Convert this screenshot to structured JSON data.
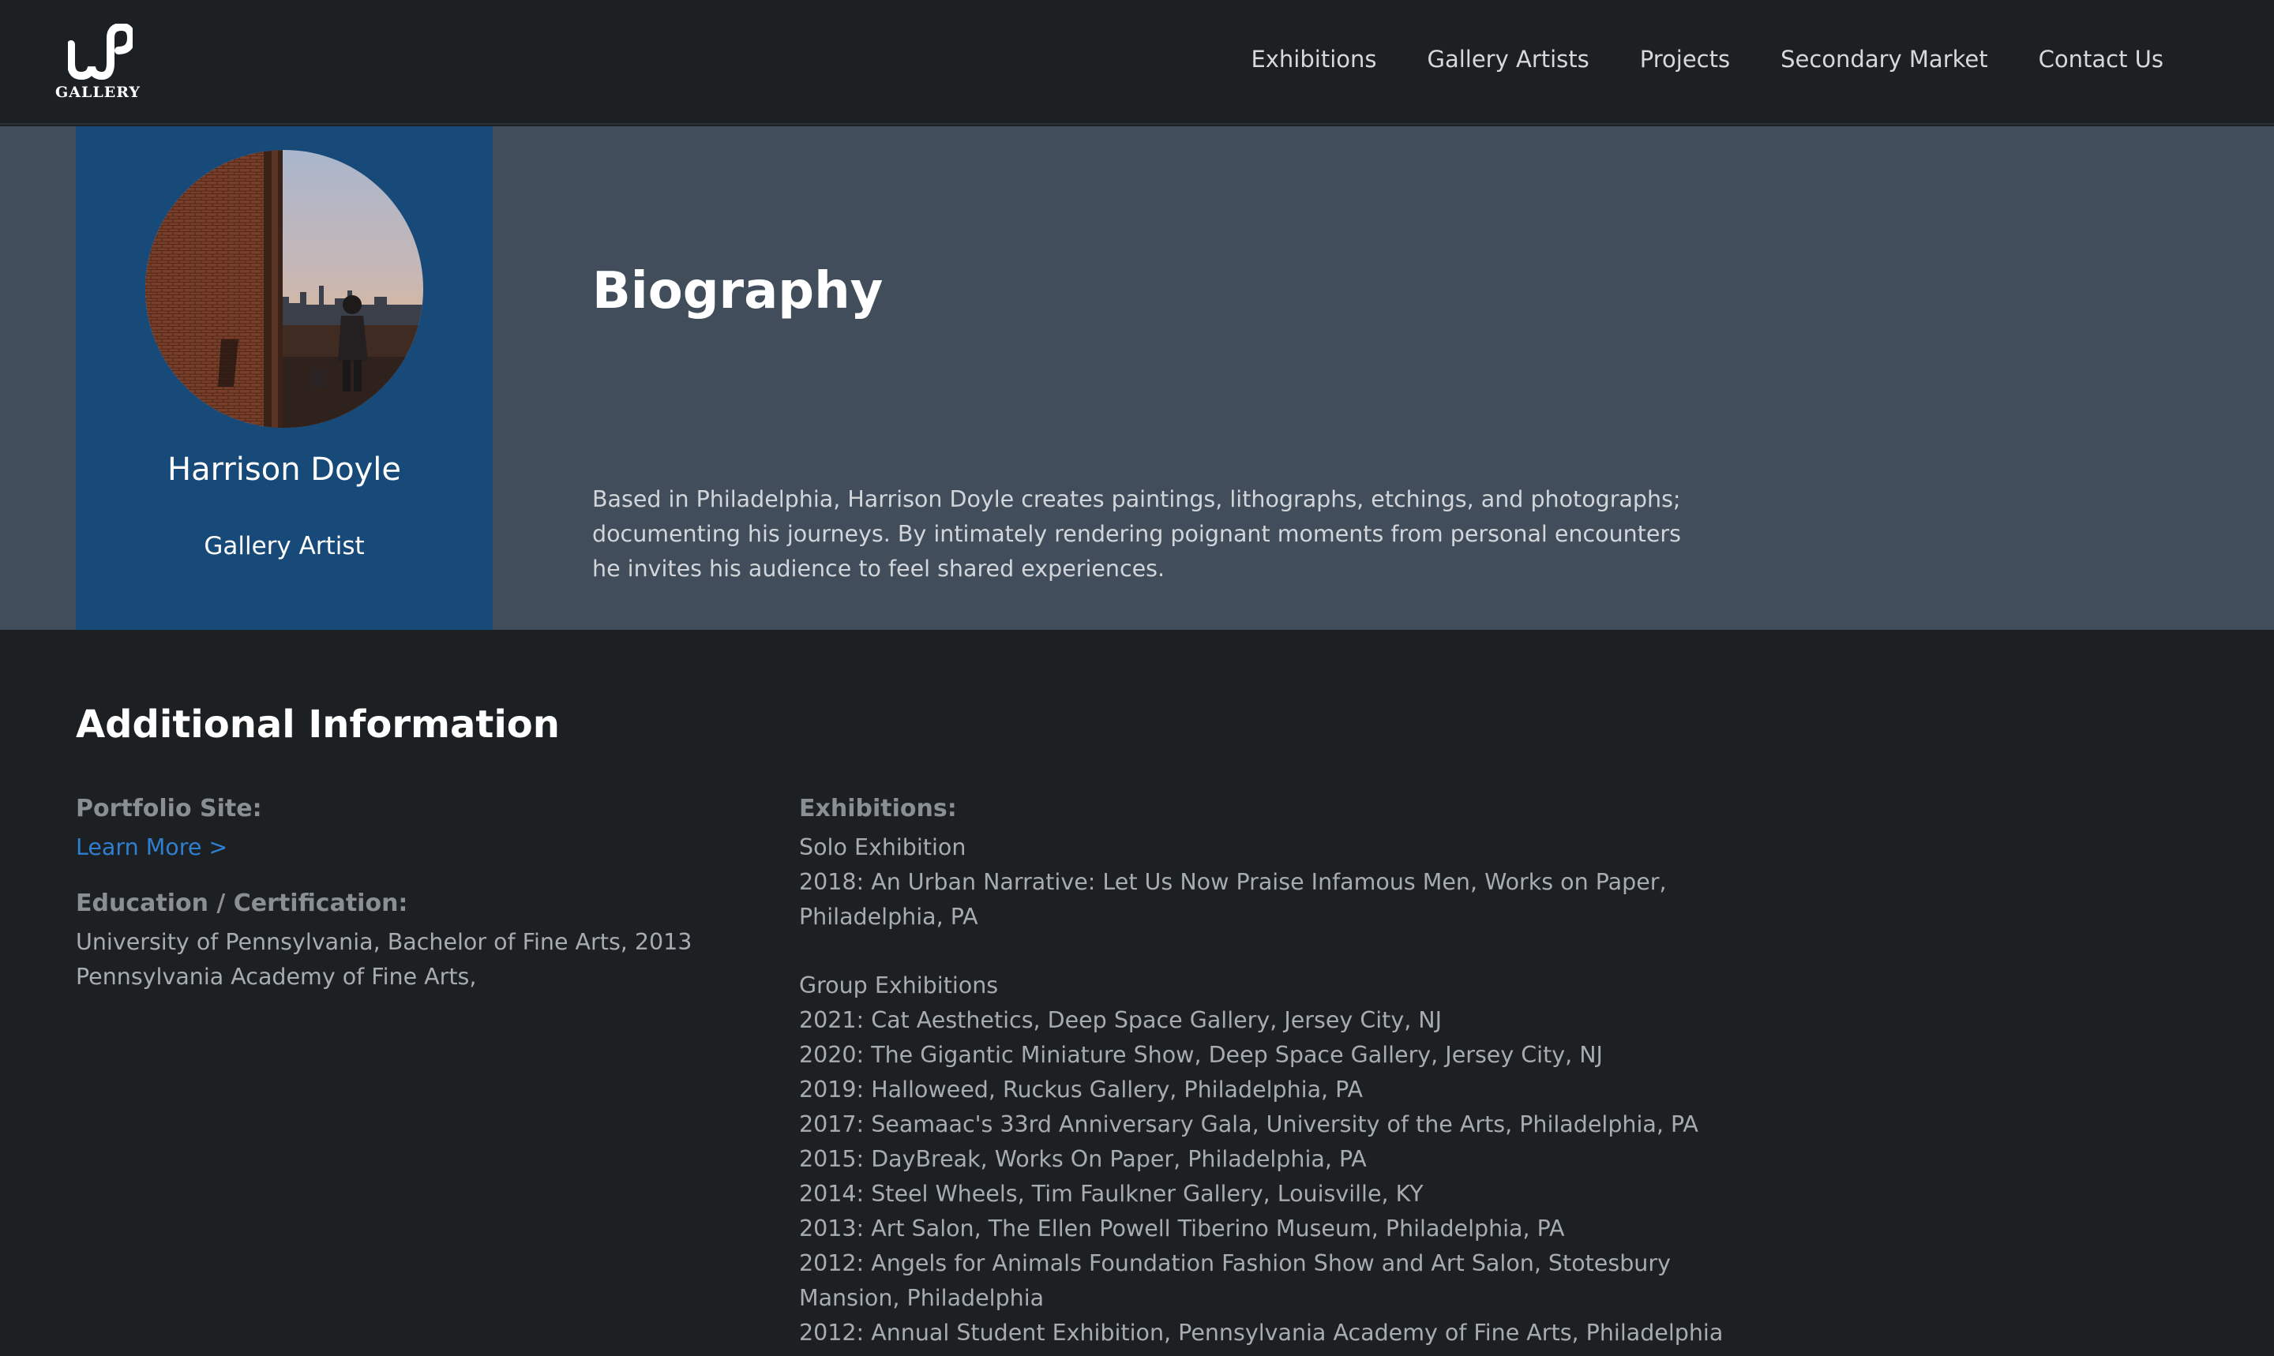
{
  "header": {
    "logo_word": "GALLERY",
    "nav": [
      "Exhibitions",
      "Gallery Artists",
      "Projects",
      "Secondary Market",
      "Contact Us"
    ]
  },
  "artist": {
    "name": "Harrison Doyle",
    "role": "Gallery Artist"
  },
  "biography": {
    "title": "Biography",
    "text": "Based in Philadelphia, Harrison Doyle creates paintings, lithographs, etchings, and photographs; documenting his journeys. By intimately rendering poignant moments from personal encounters he invites his audience to feel shared experiences."
  },
  "additional_info": {
    "title": "Additional Information",
    "portfolio_label": "Portfolio Site:",
    "portfolio_link": "Learn More >",
    "education_label": "Education / Certification:",
    "education": [
      "University of Pennsylvania, Bachelor of Fine Arts, 2013",
      "Pennsylvania Academy of Fine Arts,"
    ],
    "exhibitions_label": "Exhibitions:",
    "solo_heading": "Solo Exhibition",
    "solo": [
      "2018: An Urban Narrative: Let Us Now Praise Infamous Men, Works on Paper, Philadelphia, PA"
    ],
    "group_heading": "Group Exhibitions",
    "group": [
      "2021: Cat Aesthetics, Deep Space Gallery, Jersey City, NJ",
      "2020: The Gigantic Miniature Show, Deep Space Gallery, Jersey City, NJ",
      "2019: Halloweed, Ruckus Gallery, Philadelphia, PA",
      "2017: Seamaac's 33rd Anniversary Gala, University of the Arts, Philadelphia, PA",
      "2015: DayBreak, Works On Paper, Philadelphia, PA",
      "2014: Steel Wheels, Tim Faulkner Gallery, Louisville, KY",
      "2013: Art Salon, The Ellen Powell Tiberino Museum, Philadelphia, PA",
      "2012: Angels for Animals Foundation Fashion Show and Art Salon, Stotesbury Mansion, Philadelphia",
      "2012: Annual Student Exhibition, Pennsylvania Academy of Fine Arts, Philadelphia"
    ]
  },
  "colors": {
    "page_bg": "#1d2022",
    "bio_band": "#414d5a",
    "artist_card": "#174a79",
    "link": "#2f7fd0"
  }
}
